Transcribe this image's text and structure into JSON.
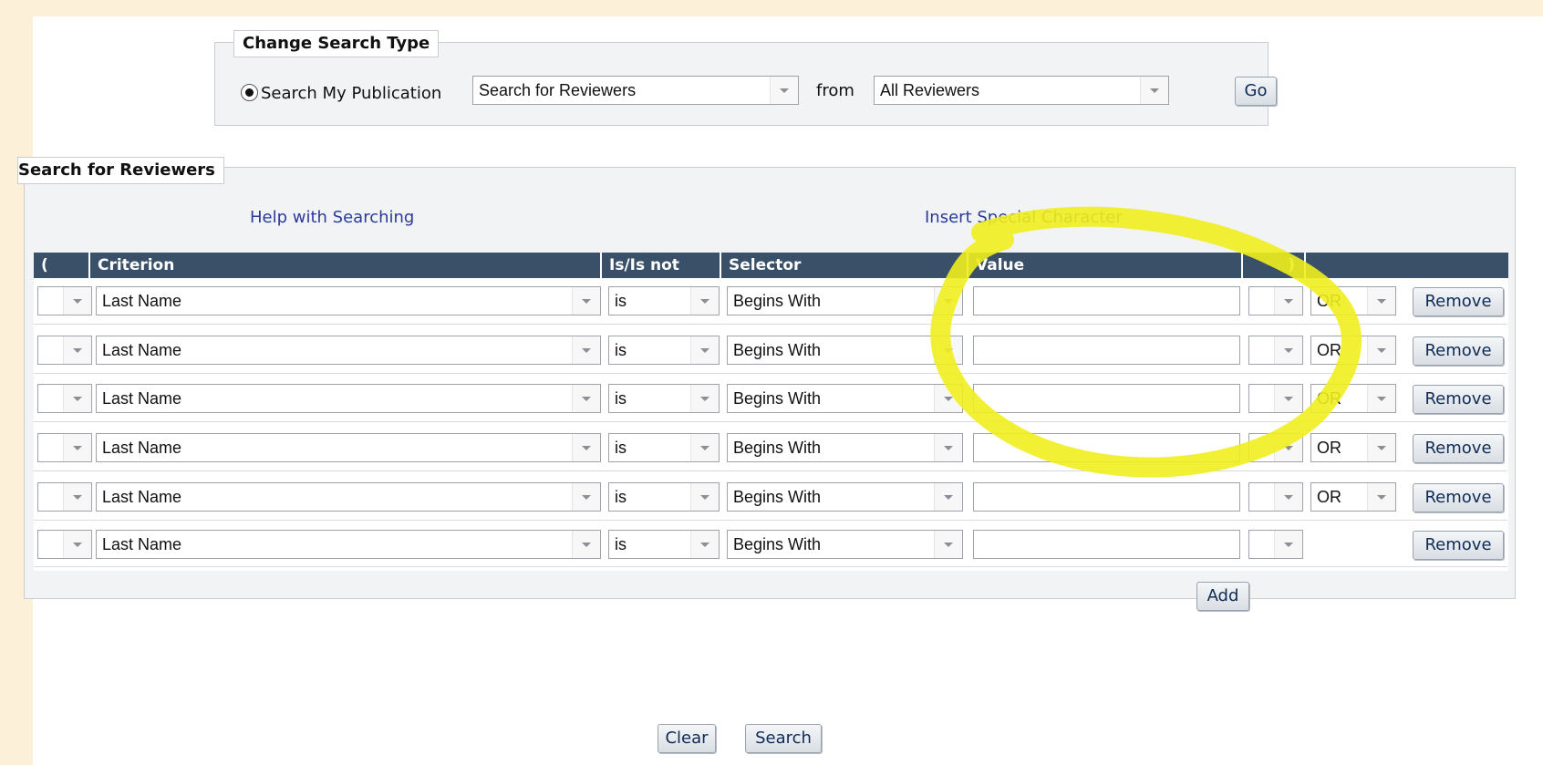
{
  "change_search": {
    "legend": "Change Search Type",
    "radio_label": "Search My Publication",
    "type_select": "Search for Reviewers",
    "from_label": "from",
    "from_select": "All Reviewers",
    "go_label": "Go"
  },
  "search_section": {
    "legend": "Search for Reviewers",
    "help_link": "Help with Searching",
    "special_char_link": "Insert Special Character"
  },
  "table": {
    "headers": {
      "open_paren": "(",
      "criterion": "Criterion",
      "is_not": "Is/Is not",
      "selector": "Selector",
      "value": "Value",
      "close_paren": ")"
    },
    "rows": [
      {
        "criterion": "Last Name",
        "is": "is",
        "selector": "Begins With",
        "value": "",
        "conj": "OR",
        "remove": "Remove"
      },
      {
        "criterion": "Last Name",
        "is": "is",
        "selector": "Begins With",
        "value": "",
        "conj": "OR",
        "remove": "Remove"
      },
      {
        "criterion": "Last Name",
        "is": "is",
        "selector": "Begins With",
        "value": "",
        "conj": "OR",
        "remove": "Remove"
      },
      {
        "criterion": "Last Name",
        "is": "is",
        "selector": "Begins With",
        "value": "",
        "conj": "OR",
        "remove": "Remove"
      },
      {
        "criterion": "Last Name",
        "is": "is",
        "selector": "Begins With",
        "value": "",
        "conj": "OR",
        "remove": "Remove"
      },
      {
        "criterion": "Last Name",
        "is": "is",
        "selector": "Begins With",
        "value": "",
        "conj": "",
        "remove": "Remove"
      }
    ],
    "add_label": "Add"
  },
  "actions": {
    "clear_label": "Clear",
    "search_label": "Search"
  },
  "colors": {
    "page_bg": "#fdf0d8",
    "header_bg": "#3a5068",
    "highlight": "#f0ee1e"
  }
}
